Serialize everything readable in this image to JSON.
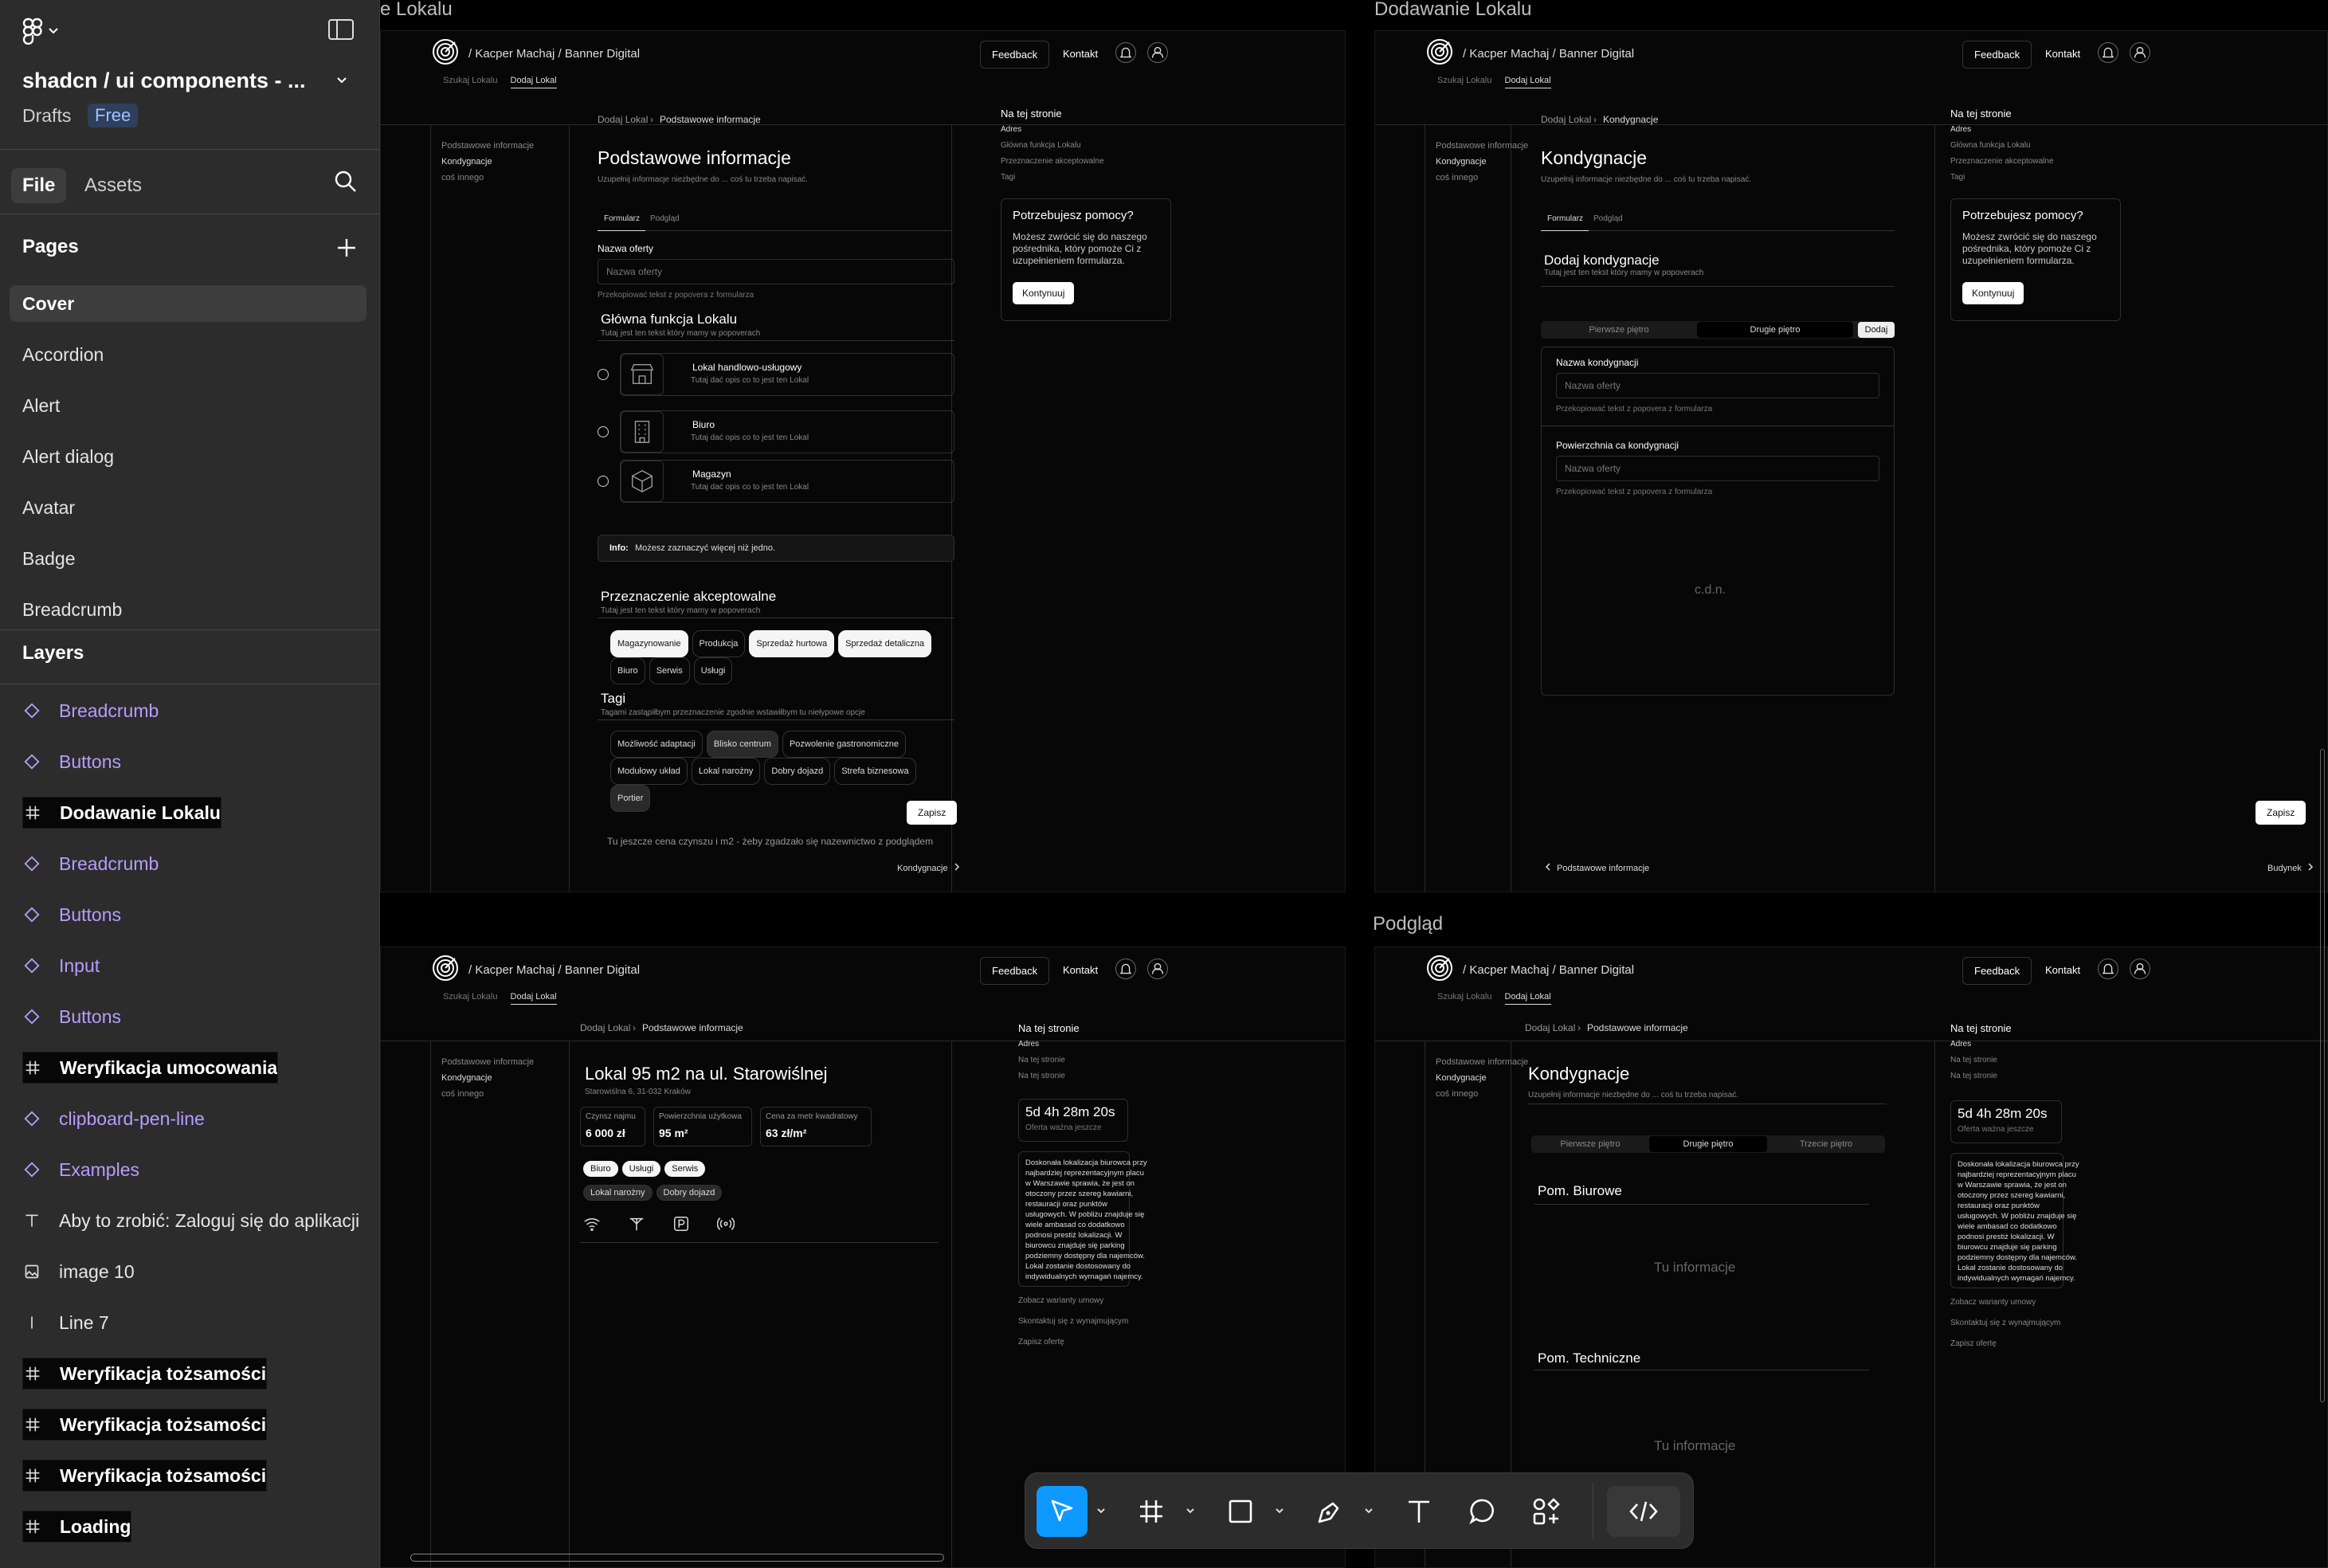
{
  "sidebar": {
    "project_title": "shadcn / ui components - ...",
    "drafts_label": "Drafts",
    "plan_badge": "Free",
    "tabs": {
      "file": "File",
      "assets": "Assets"
    },
    "pages_title": "Pages",
    "pages": [
      "Cover",
      "Accordion",
      "Alert",
      "Alert dialog",
      "Avatar",
      "Badge",
      "Breadcrumb"
    ],
    "selected_page": "Cover",
    "layers_title": "Layers",
    "layers": [
      {
        "label": "Breadcrumb",
        "kind": "component"
      },
      {
        "label": "Buttons",
        "kind": "component"
      },
      {
        "label": "Dodawanie Lokalu",
        "kind": "frame"
      },
      {
        "label": "Breadcrumb",
        "kind": "component"
      },
      {
        "label": "Buttons",
        "kind": "component"
      },
      {
        "label": "Input",
        "kind": "component"
      },
      {
        "label": "Buttons",
        "kind": "component"
      },
      {
        "label": "Weryfikacja umocowania",
        "kind": "frame"
      },
      {
        "label": "clipboard-pen-line",
        "kind": "component"
      },
      {
        "label": "Examples",
        "kind": "component"
      },
      {
        "label": "Aby to zrobić:  Zaloguj się do aplikacji",
        "kind": "text"
      },
      {
        "label": "image 10",
        "kind": "image"
      },
      {
        "label": "Line 7",
        "kind": "line"
      },
      {
        "label": "Weryfikacja tożsamości",
        "kind": "frame"
      },
      {
        "label": "Weryfikacja tożsamości",
        "kind": "frame"
      },
      {
        "label": "Weryfikacja tożsamości",
        "kind": "frame"
      },
      {
        "label": "Loading",
        "kind": "frame"
      }
    ]
  },
  "canvas": {
    "frame_labels": {
      "f1": "e Lokalu",
      "f2": "Dodawanie Lokalu",
      "f4": "Podgląd"
    },
    "common": {
      "crumb": "/ Kacper Machaj / Banner Digital",
      "feedback": "Feedback",
      "kontakt": "Kontakt",
      "subtab1": "Szukaj Lokalu",
      "subtab2": "Dodaj Lokal",
      "side_links": [
        "Podstawowe informacje",
        "Kondygnacje",
        "coś innego"
      ],
      "on_page": "Na tej stronie",
      "help_title": "Potrzebujesz pomocy?",
      "help_text1": "Możesz zwrócić się do naszego",
      "help_text2": "pośrednika, który pomoże Ci z",
      "help_text3": "uzupełnieniem formularza.",
      "continue": "Kontynuuj",
      "save": "Zapisz",
      "form_tab": "Formularz",
      "preview_tab": "Podgląd",
      "offer_placeholder": "Nazwa oferty"
    },
    "f1": {
      "bc_root": "Dodaj Lokal",
      "bc_current": "Podstawowe informacje",
      "title": "Podstawowe informacje",
      "subtitle": "Uzupełnij informacje niezbędne do ... coś tu trzeba napisać.",
      "toc": [
        "Adres",
        "Główna funkcja Lokalu",
        "Przeznaczenie akceptowalne",
        "Tagi"
      ],
      "name_label": "Nazwa oferty",
      "name_help": "Przekopiować tekst z popovera z formularza",
      "func_title": "Główna funkcja Lokalu",
      "func_sub": "Tutaj jest ten tekst który mamy w popoverach",
      "options": [
        {
          "title": "Lokal handlowo-usługowy",
          "desc": "Tutaj dać opis co to jest ten Lokal"
        },
        {
          "title": "Biuro",
          "desc": "Tutaj dać opis co to jest ten Lokal"
        },
        {
          "title": "Magazyn",
          "desc": "Tutaj dać opis co to jest ten Lokal"
        }
      ],
      "info_bold": "Info:",
      "info_text": "Możesz zaznaczyć więcej niż jedno.",
      "purpose_title": "Przeznaczenie akceptowalne",
      "purpose_sub": "Tutaj jest ten tekst który mamy w popoverach",
      "purpose_chips": [
        "Magazynowanie",
        "Produkcja",
        "Sprzedaż hurtowa",
        "Sprzedaż detaliczna",
        "Biuro",
        "Serwis",
        "Usługi"
      ],
      "tags_title": "Tagi",
      "tags_sub": "Tagami zastąpiłbym przeznaczenie zgodnie wstawiłbym tu niełypowe opcje",
      "tag_chips": [
        "Możliwość adaptacji",
        "Blisko centrum",
        "Pozwolenie gastronomiczne",
        "Modułowy układ",
        "Lokal narożny",
        "Dobry dojazd",
        "Strefa biznesowa",
        "Portier"
      ],
      "note": "Tu jeszcze cena czynszu i m2 - żeby zgadzało się nazewnictwo z podglądem",
      "next": "Kondygnacje"
    },
    "f2": {
      "bc_root": "Dodaj Lokal",
      "bc_current": "Kondygnacje",
      "title": "Kondygnacje",
      "subtitle": "Uzupełnij informacje niezbędne do ... coś tu trzeba napisać.",
      "toc": [
        "Adres",
        "Główna funkcja Lokalu",
        "Przeznaczenie akceptowalne",
        "Tagi"
      ],
      "add_title": "Dodaj kondygnacje",
      "add_sub": "Tutaj jest ten tekst który mamy w popoverach",
      "floors": [
        "Pierwsze piętro",
        "Drugie piętro"
      ],
      "add_btn": "Dodaj",
      "field1": "Nazwa kondygnacji",
      "field2": "Powierzchnia ca kondygnacji",
      "help": "Przekopiować tekst z popovera z formularza",
      "cdn": "c.d.n.",
      "prev": "Podstawowe informacje",
      "next": "Budynek"
    },
    "f3": {
      "bc_root": "Dodaj Lokal",
      "bc_current": "Podstawowe informacje",
      "title": "Lokal 95 m2 na ul. Starowiślnej",
      "address": "Starowiślna 6, 31-032 Kraków",
      "stats": [
        {
          "label": "Czynsz najmu",
          "value": "6 000 zł"
        },
        {
          "label": "Powierzchnia użytkowa",
          "value": "95 m²"
        },
        {
          "label": "Cena za metr kwadratowy",
          "value": "63 zł/m²"
        }
      ],
      "chips": [
        "Biuro",
        "Usługi",
        "Serwis"
      ],
      "chips2": [
        "Lokal narożny",
        "Dobry dojazd"
      ],
      "toc": [
        "Adres",
        "Na tej stronie",
        "Na tej stronie"
      ],
      "timer": "5d 4h 28m 20s",
      "timer_sub": "Oferta ważna jeszcze",
      "desc": [
        "Doskonała lokalizacja biurowca przy",
        "najbardziej reprezentacyjnym placu",
        "w Warszawie sprawia, że jest on",
        "otoczony przez szereg kawiarni,",
        "restauracji oraz punktów",
        "usługowych. W pobliżu znajduje się",
        "wiele ambasad co dodatkowo",
        "podnosi prestiż lokalizacji. W",
        "biurowcu znajduje się parking",
        "podziemny dostępny dla najemców.",
        "Lokal zostanie dostosowany do",
        "indywidualnych wymagań najemcy."
      ],
      "links": [
        "Zobacz warianty umowy",
        "Skontaktuj się z wynajmującym",
        "Zapisz ofertę"
      ]
    },
    "f4": {
      "bc_root": "Dodaj Lokal",
      "bc_current": "Podstawowe informacje",
      "title": "Kondygnacje",
      "subtitle": "Uzupełnij informacje niezbędne do ... coś tu trzeba napisać.",
      "floors": [
        "Pierwsze piętro",
        "Drugie piętro",
        "Trzecie piętro"
      ],
      "room1": "Pom. Biurowe",
      "room2": "Pom. Techniczne",
      "info": "Tu informacje",
      "toc": [
        "Adres",
        "Na tej stronie",
        "Na tej stronie"
      ]
    }
  }
}
